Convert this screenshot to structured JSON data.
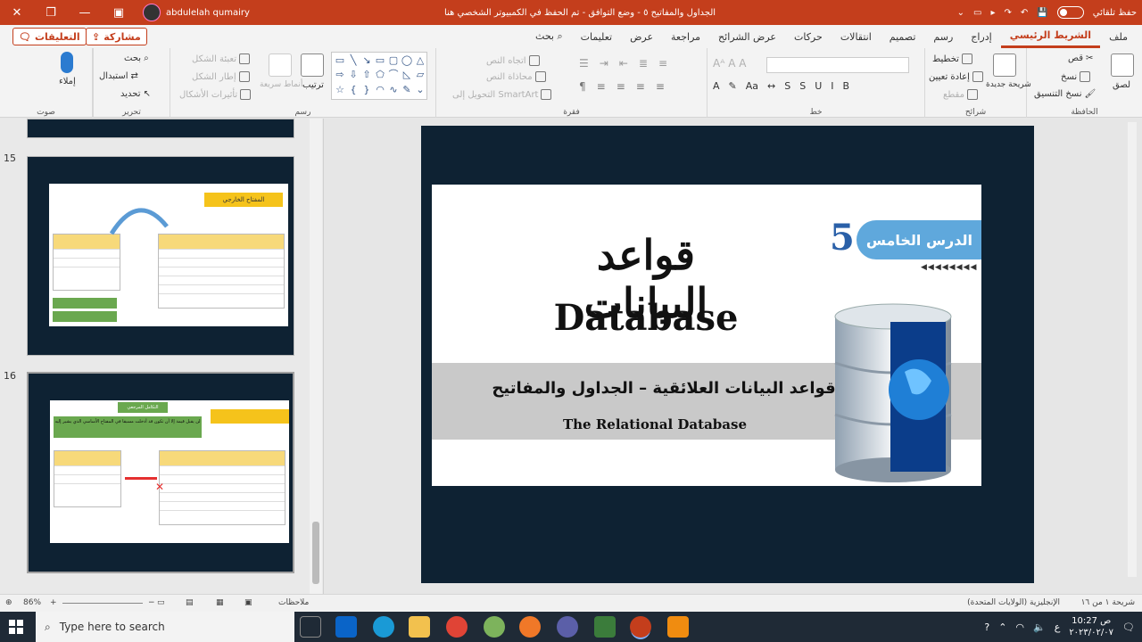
{
  "titlebar": {
    "document_title": "الجداول والمفاتيح ٥ - وضع التوافق - تم الحفظ في الكمبيوتر الشخصي هنا",
    "user_name": "abdulelah qumairy",
    "autosave_label": "حفظ تلقائي",
    "close": "✕",
    "restore": "❐",
    "minimize": "—",
    "ribbon_display": "▣"
  },
  "tabs": [
    "ملف",
    "الشريط الرئيسي",
    "إدراج",
    "رسم",
    "تصميم",
    "انتقالات",
    "حركات",
    "عرض الشرائح",
    "مراجعة",
    "عرض",
    "تعليمات",
    "بحث"
  ],
  "active_tab": "الشريط الرئيسي",
  "share_label": "مشاركة",
  "comments_label": "التعليقات",
  "ribbon": {
    "clipboard": {
      "label": "الحافظة",
      "paste": "لصق",
      "cut": "قص",
      "copy": "نسخ",
      "format_painter": "نسخ التنسيق"
    },
    "slides": {
      "label": "شرائح",
      "new_slide": "شريحة جديدة",
      "layout": "تخطيط",
      "reset": "إعادة تعيين",
      "section": "مقطع"
    },
    "font": {
      "label": "خط"
    },
    "paragraph": {
      "label": "فقرة",
      "text_direction": "اتجاه النص",
      "align_text": "محاذاة النص",
      "convert_smartart": "التحويل إلى SmartArt"
    },
    "drawing": {
      "label": "رسم",
      "arrange": "ترتيب",
      "quick_styles": "أنماط سريعة",
      "shape_fill": "تعبئة الشكل",
      "shape_outline": "إطار الشكل",
      "shape_effects": "تأثيرات الأشكال"
    },
    "editing": {
      "label": "تحرير",
      "find": "بحث",
      "replace": "استبدال",
      "select": "تحديد"
    },
    "voice": {
      "label": "صوت",
      "dictate": "إملاء"
    }
  },
  "thumbnails": [
    {
      "number": "15",
      "title": "المفتاح الخارجي"
    },
    {
      "number": "16",
      "title": "التكامل المرجعي",
      "note": "لن يقبل قيمة إلا أن تكون قد أدخلت مسبقا في المفتاح الأساسي الذي يشير إليه"
    }
  ],
  "slide": {
    "lesson_badge": "الدرس الخامس",
    "lesson_number": "5",
    "title_ar": "قواعد البيانات",
    "title_en": "Database",
    "subtitle_ar": "قواعد البيانات العلائقية – الجداول والمفاتيح",
    "subtitle_en": "The Relational Database"
  },
  "statusbar": {
    "slide_info": "شريحة ١ من ١٦",
    "language": "الإنجليزية (الولايات المتحدة)",
    "notes": "ملاحظات",
    "zoom": "86%"
  },
  "taskbar": {
    "search_placeholder": "Type here to search",
    "time": "10:27 ص",
    "date": "٢٠٢٣/٠٢/٠٧",
    "lang": "ع"
  },
  "colors": {
    "accent": "#c43e1c",
    "slide_dark": "#0e2233",
    "badge": "#5fa8dc"
  }
}
